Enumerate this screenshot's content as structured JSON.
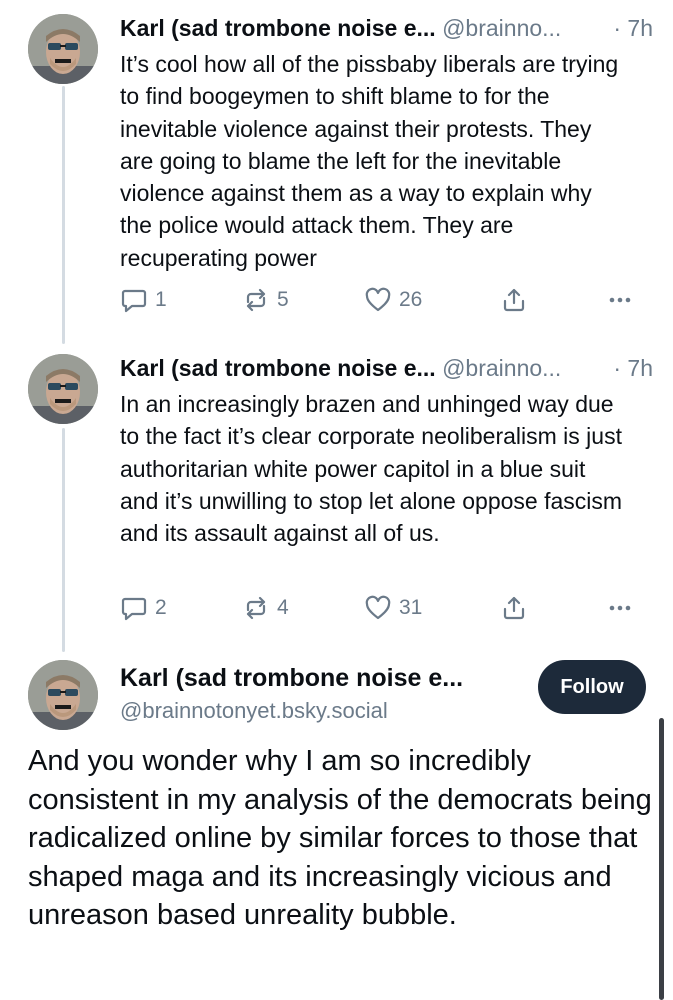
{
  "posts": [
    {
      "author_name": "Karl (sad trombone noise e...",
      "handle": "@brainno...",
      "time": "· 7h",
      "text": "It’s cool how all of the pissbaby liberals are trying to find boogeymen to shift blame to for the inevitable violence against their protests. They are going to blame the left for the inevitable violence against them as a way to explain why the police would attack them. They are recuperating power",
      "replies": "1",
      "reposts": "5",
      "likes": "26"
    },
    {
      "author_name": "Karl (sad trombone noise e...",
      "handle": "@brainno...",
      "time": "· 7h",
      "text": "In an increasingly brazen and unhinged way due to the fact it’s clear corporate neoliberalism is just authoritarian white power capitol in a blue suit and it’s unwilling to stop let alone oppose fascism and its assault against all of us.",
      "replies": "2",
      "reposts": "4",
      "likes": "31"
    }
  ],
  "main_post": {
    "author_name": "Karl (sad trombone noise e...",
    "handle": "@brainnotonyet.bsky.social",
    "follow_label": "Follow",
    "text": "And you wonder why I am so incredibly consistent in my analysis of the democrats being radicalized online by similar forces to those that shaped maga and its increasingly vicious and unreason based unreality bubble."
  },
  "icons": {
    "reply": "reply-icon",
    "repost": "repost-icon",
    "like": "heart-icon",
    "share": "share-icon",
    "more": "more-icon"
  },
  "colors": {
    "muted": "#6b7a89",
    "follow_button": "#1d2a3a",
    "thread_line": "#d4dbe2"
  }
}
